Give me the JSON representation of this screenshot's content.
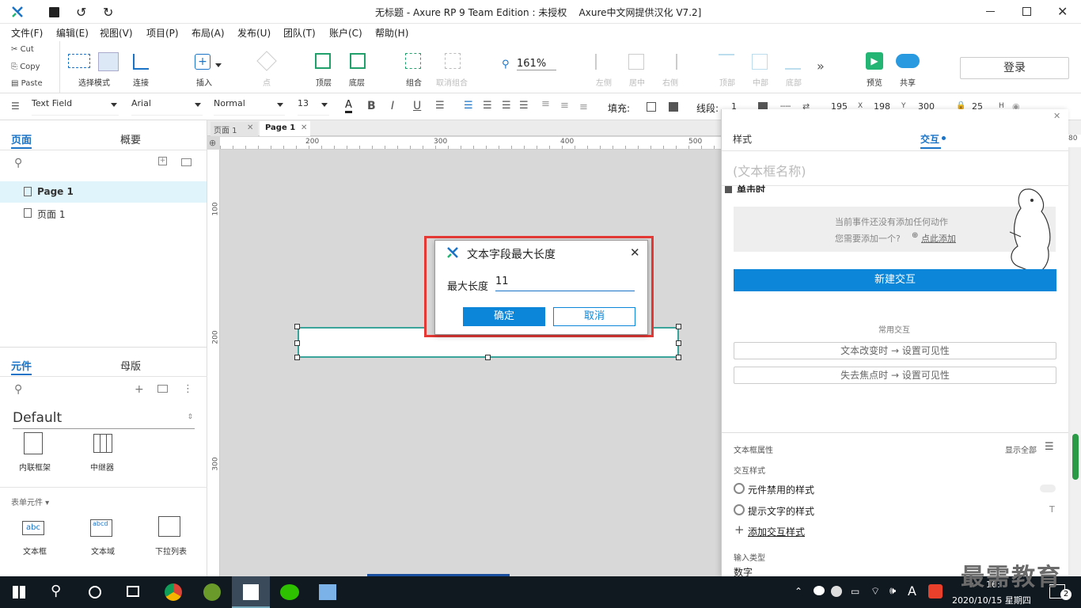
{
  "window": {
    "title": "无标题 - Axure RP 9 Team Edition : 未授权    Axure中文网提供汉化 V7.2]"
  },
  "menu": [
    "文件(F)",
    "编辑(E)",
    "视图(V)",
    "项目(P)",
    "布局(A)",
    "发布(U)",
    "团队(T)",
    "账户(C)",
    "帮助(H)"
  ],
  "clipboard": {
    "cut": "Cut",
    "copy": "Copy",
    "paste": "Paste"
  },
  "toolbar": {
    "select_mode": "选择模式",
    "connect": "连接",
    "insert": "插入",
    "point": "点",
    "top": "顶层",
    "bottom": "底层",
    "group": "组合",
    "ungroup": "取消组合",
    "zoom": "161%",
    "left": "左侧",
    "center": "居中",
    "right": "右侧",
    "vtop": "顶部",
    "vmid": "中部",
    "vbottom": "底部",
    "preview": "预览",
    "share": "共享",
    "login": "登录"
  },
  "format": {
    "widget_type": "Text Field",
    "font": "Arial",
    "weight": "Normal",
    "size": "13",
    "fill_label": "填充:",
    "line_label": "线段:",
    "line_value": "1",
    "x": "195",
    "x_label": "X",
    "y": "198",
    "y_label": "Y",
    "w": "300",
    "h": "25",
    "h_label": "H"
  },
  "left": {
    "tab_pages": "页面",
    "tab_outline": "概要",
    "pages": [
      "Page 1",
      "页面 1"
    ],
    "tab_widgets": "元件",
    "tab_masters": "母版",
    "library": "Default",
    "widgets_top": [
      "内联框架",
      "中继器"
    ],
    "form_section": "表单元件 ▾",
    "widgets_form": [
      "文本框",
      "文本域",
      "下拉列表"
    ]
  },
  "canvas": {
    "tabs": [
      "页面 1",
      "Page 1"
    ],
    "ruler_h": [
      "200",
      "300",
      "400",
      "500"
    ],
    "ruler_v": [
      "100",
      "200",
      "300"
    ]
  },
  "dialog": {
    "title": "文本字段最大长度",
    "label": "最大长度",
    "value": "11",
    "ok": "确定",
    "cancel": "取消"
  },
  "right": {
    "tab_style": "样式",
    "tab_interact": "交互",
    "name_placeholder": "(文本框名称)",
    "event": "单击时",
    "empty1": "当前事件还没有添加任何动作",
    "empty2": "您需要添加一个?",
    "empty_link": "点此添加",
    "new_interaction": "新建交互",
    "common": "常用交互",
    "common_items": [
      "文本改变时 → 设置可见性",
      "失去焦点时 → 设置可见性"
    ],
    "props_title": "文本框属性",
    "show_all": "显示全部",
    "interact_styles": "交互样式",
    "style_disabled": "元件禁用的样式",
    "style_hint": "提示文字的样式",
    "add_style": "添加交互样式",
    "input_type": "输入类型",
    "input_value": "数字"
  },
  "taskbar": {
    "date": "2020/10/15 星期四",
    "time": "16:",
    "badge": "2",
    "ime": "A"
  },
  "watermark": "最需教育",
  "colors": {
    "accent": "#1a73c6",
    "primary_button": "#0b86d9",
    "dialog_border": "#e53935"
  }
}
